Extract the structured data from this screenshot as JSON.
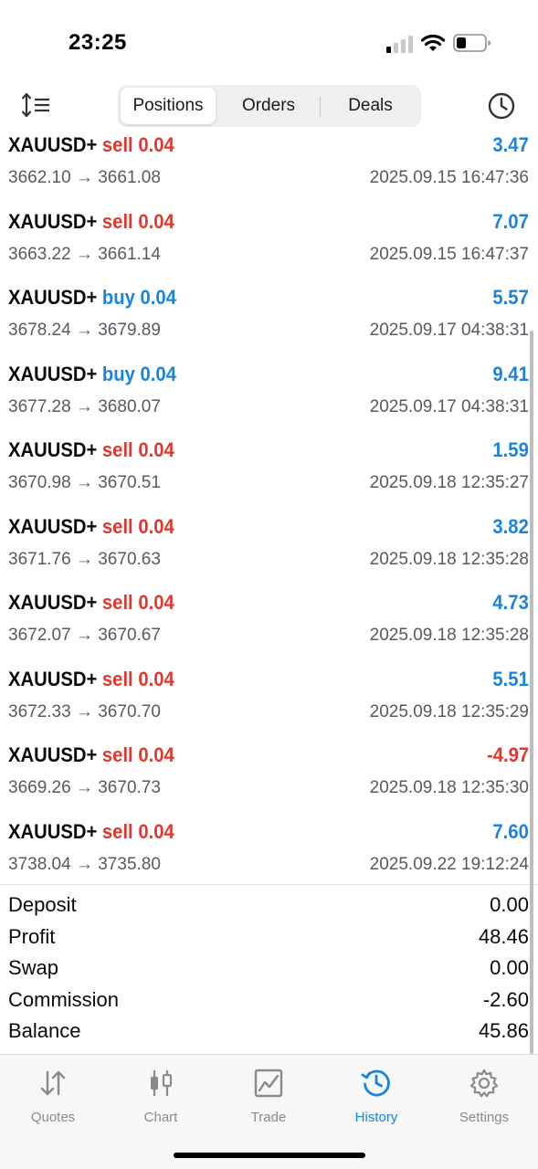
{
  "status_bar": {
    "time": "23:25"
  },
  "toolbar": {
    "tabs": [
      {
        "label": "Positions",
        "active": true
      },
      {
        "label": "Orders",
        "active": false
      },
      {
        "label": "Deals",
        "active": false
      }
    ]
  },
  "deals": [
    {
      "symbol": "XAUUSD+",
      "type": "sell",
      "volume": "0.04",
      "profit": "3.47",
      "prices": "3662.10 → 3661.08",
      "time": "2025.09.15 16:47:36"
    },
    {
      "symbol": "XAUUSD+",
      "type": "sell",
      "volume": "0.04",
      "profit": "7.07",
      "prices": "3663.22 → 3661.14",
      "time": "2025.09.15 16:47:37"
    },
    {
      "symbol": "XAUUSD+",
      "type": "buy",
      "volume": "0.04",
      "profit": "5.57",
      "prices": "3678.24 → 3679.89",
      "time": "2025.09.17 04:38:31"
    },
    {
      "symbol": "XAUUSD+",
      "type": "buy",
      "volume": "0.04",
      "profit": "9.41",
      "prices": "3677.28 → 3680.07",
      "time": "2025.09.17 04:38:31"
    },
    {
      "symbol": "XAUUSD+",
      "type": "sell",
      "volume": "0.04",
      "profit": "1.59",
      "prices": "3670.98 → 3670.51",
      "time": "2025.09.18 12:35:27"
    },
    {
      "symbol": "XAUUSD+",
      "type": "sell",
      "volume": "0.04",
      "profit": "3.82",
      "prices": "3671.76 → 3670.63",
      "time": "2025.09.18 12:35:28"
    },
    {
      "symbol": "XAUUSD+",
      "type": "sell",
      "volume": "0.04",
      "profit": "4.73",
      "prices": "3672.07 → 3670.67",
      "time": "2025.09.18 12:35:28"
    },
    {
      "symbol": "XAUUSD+",
      "type": "sell",
      "volume": "0.04",
      "profit": "5.51",
      "prices": "3672.33 → 3670.70",
      "time": "2025.09.18 12:35:29"
    },
    {
      "symbol": "XAUUSD+",
      "type": "sell",
      "volume": "0.04",
      "profit": "-4.97",
      "prices": "3669.26 → 3670.73",
      "time": "2025.09.18 12:35:30"
    },
    {
      "symbol": "XAUUSD+",
      "type": "sell",
      "volume": "0.04",
      "profit": "7.60",
      "prices": "3738.04 → 3735.80",
      "time": "2025.09.22 19:12:24"
    }
  ],
  "summary": [
    {
      "label": "Deposit",
      "value": "0.00"
    },
    {
      "label": "Profit",
      "value": "48.46"
    },
    {
      "label": "Swap",
      "value": "0.00"
    },
    {
      "label": "Commission",
      "value": "-2.60"
    },
    {
      "label": "Balance",
      "value": "45.86"
    }
  ],
  "tabbar": {
    "items": [
      {
        "label": "Quotes",
        "icon": "quotes-arrows-icon",
        "active": false
      },
      {
        "label": "Chart",
        "icon": "candlestick-icon",
        "active": false
      },
      {
        "label": "Trade",
        "icon": "trade-chart-icon",
        "active": false
      },
      {
        "label": "History",
        "icon": "history-clock-icon",
        "active": true
      },
      {
        "label": "Settings",
        "icon": "gear-icon",
        "active": false
      }
    ]
  },
  "colors": {
    "sell": "#e0382e",
    "buy": "#1a84dc",
    "profit_positive": "#1a84dc",
    "profit_negative": "#e0382e",
    "active_tab": "#1a84dc",
    "inactive_tab": "#8a8a8e"
  }
}
